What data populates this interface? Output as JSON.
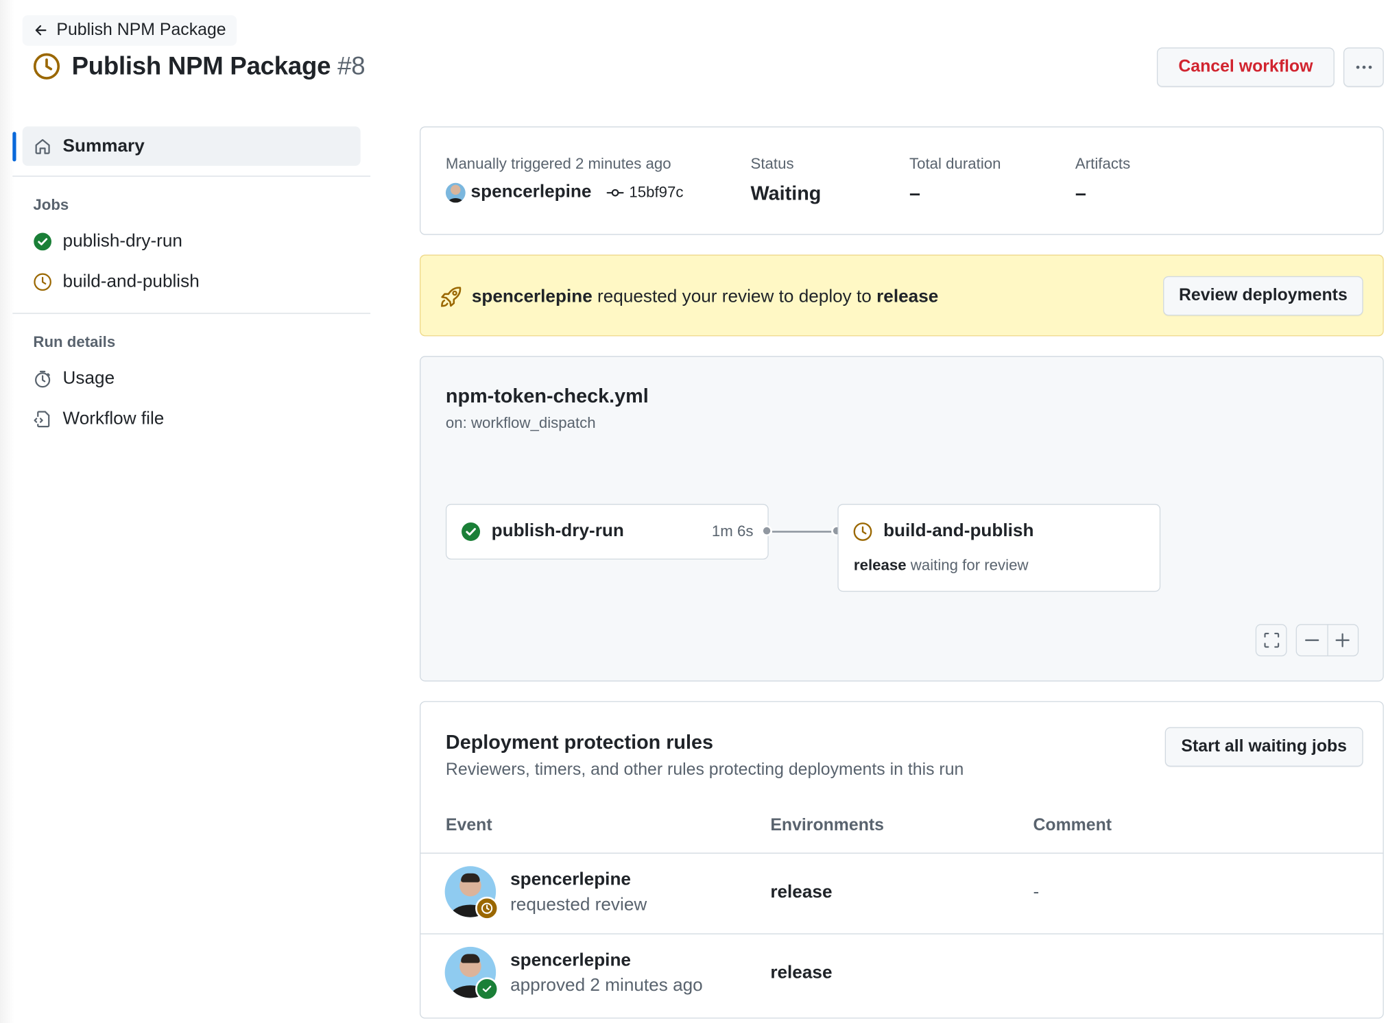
{
  "header": {
    "back_label": "Publish NPM Package",
    "title": "Publish NPM Package",
    "run_number": "#8",
    "cancel_label": "Cancel workflow",
    "more_label": "..."
  },
  "sidebar": {
    "summary_label": "Summary",
    "jobs_heading": "Jobs",
    "jobs": [
      {
        "label": "publish-dry-run",
        "status": "success"
      },
      {
        "label": "build-and-publish",
        "status": "waiting"
      }
    ],
    "run_details_heading": "Run details",
    "details": [
      {
        "label": "Usage",
        "icon": "stopwatch-icon"
      },
      {
        "label": "Workflow file",
        "icon": "file-code-icon"
      }
    ]
  },
  "summary": {
    "trigger_label": "Manually triggered 2 minutes ago",
    "actor": "spencerlepine",
    "commit": "15bf97c",
    "status_label": "Status",
    "status_value": "Waiting",
    "duration_label": "Total duration",
    "duration_value": "–",
    "artifacts_label": "Artifacts",
    "artifacts_value": "–"
  },
  "banner": {
    "actor": "spencerlepine",
    "text_middle": "requested your review to deploy to",
    "environment": "release",
    "button_label": "Review deployments"
  },
  "graph": {
    "file": "npm-token-check.yml",
    "trigger": "on: workflow_dispatch",
    "job1": {
      "name": "publish-dry-run",
      "time": "1m 6s"
    },
    "job2": {
      "name": "build-and-publish",
      "env": "release",
      "note": "waiting for review"
    }
  },
  "rules": {
    "title": "Deployment protection rules",
    "subtitle": "Reviewers, timers, and other rules protecting deployments in this run",
    "start_label": "Start all waiting jobs",
    "columns": [
      "Event",
      "Environments",
      "Comment"
    ],
    "rows": [
      {
        "user": "spencerlepine",
        "action": "requested review",
        "env": "release",
        "comment": "-"
      },
      {
        "user": "spencerlepine",
        "action": "approved 2 minutes ago",
        "env": "release",
        "comment": ""
      }
    ]
  },
  "colors": {
    "waiting": "#9a6700",
    "success": "#1a7f37",
    "danger": "#d1242f",
    "accent": "#0969da"
  }
}
